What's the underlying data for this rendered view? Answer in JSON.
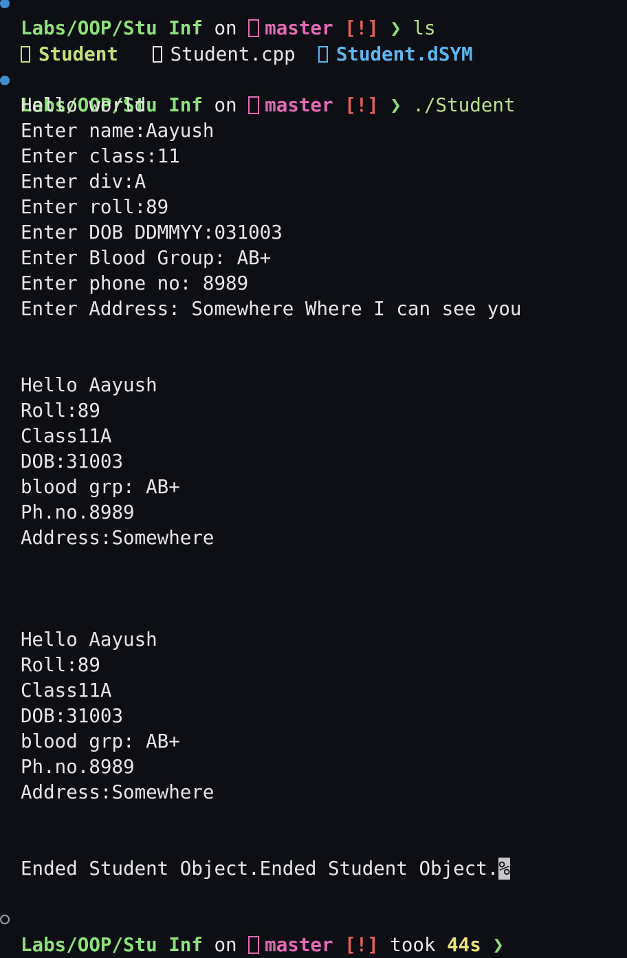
{
  "prompt_top": {
    "path": "Labs/OOP/Stu Inf",
    "on": "on",
    "branch": "master",
    "status": "[!]",
    "chevron": "❯",
    "command": "ls"
  },
  "ls_output": {
    "item1": "Student",
    "item2": "Student.cpp",
    "item3": "Student.dSYM"
  },
  "prompt_run": {
    "path": "Labs/OOP/Stu Inf",
    "on": "on",
    "branch": "master",
    "status": "[!]",
    "chevron": "❯",
    "command": "./Student"
  },
  "output": {
    "l1": "Hello world",
    "l2": "Enter name:Aayush",
    "l3": "Enter class:11",
    "l4": "Enter div:A",
    "l5": "Enter roll:89",
    "l6": "Enter DOB DDMMYY:031003",
    "l7": "Enter Blood Group: AB+",
    "l8": "Enter phone no: 8989",
    "l9": "Enter Address: Somewhere Where I can see you",
    "block1": {
      "hello": "Hello Aayush",
      "roll": "Roll:89",
      "class": "Class11A",
      "dob": "DOB:31003",
      "blood": "blood grp: AB+",
      "phone": "Ph.no.8989",
      "address": "Address:Somewhere"
    },
    "block2": {
      "hello": "Hello Aayush",
      "roll": "Roll:89",
      "class": "Class11A",
      "dob": "DOB:31003",
      "blood": "blood grp: AB+",
      "phone": "Ph.no.8989",
      "address": "Address:Somewhere"
    },
    "ended": "Ended Student Object.Ended Student Object.",
    "percent": "%"
  },
  "prompt_final": {
    "path": "Labs/OOP/Stu Inf",
    "on": "on",
    "branch": "master",
    "status": "[!]",
    "took": "took",
    "duration": "44s",
    "chevron": "❯"
  },
  "colors": {
    "background": "#0e0f14",
    "path": "#8ee07a",
    "branch": "#e36ab3",
    "status": "#e0605a",
    "directory": "#5eb6f0",
    "duration": "#ece27a"
  }
}
